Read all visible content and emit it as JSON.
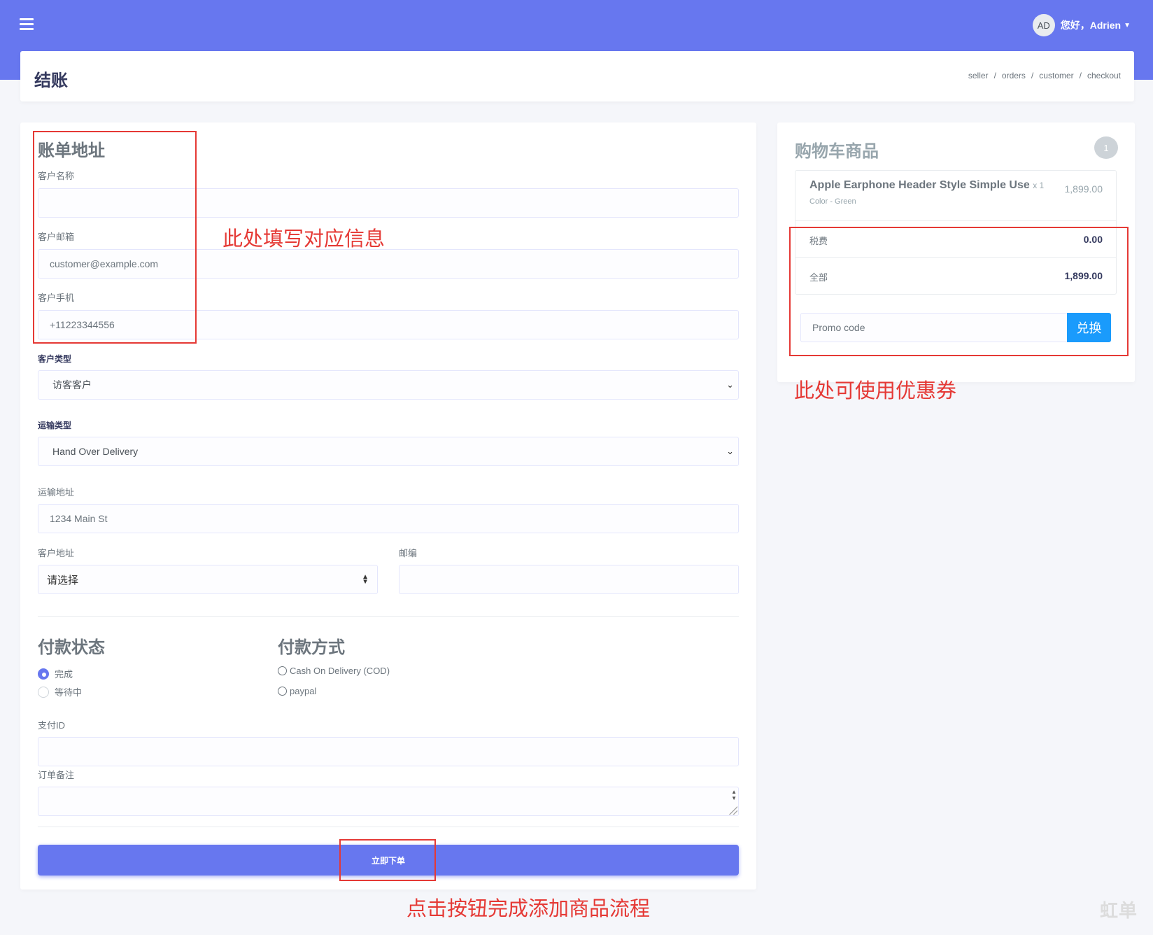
{
  "topbar": {
    "avatar_initials": "AD",
    "greeting": "您好，Adrien"
  },
  "header": {
    "title": "结账",
    "breadcrumb": [
      "seller",
      "orders",
      "customer",
      "checkout"
    ]
  },
  "billing": {
    "title": "账单地址",
    "name_label": "客户名称",
    "name_value": "",
    "email_label": "客户邮箱",
    "email_placeholder": "customer@example.com",
    "phone_label": "客户手机",
    "phone_placeholder": "+11223344556",
    "customer_type_label": "客户类型",
    "customer_type_value": "访客客户",
    "shipping_type_label": "运输类型",
    "shipping_type_value": "Hand Over Delivery",
    "shipping_address_label": "运输地址",
    "shipping_address_placeholder": "1234 Main St",
    "customer_address_label": "客户地址",
    "customer_address_value": "请选择",
    "zip_label": "邮编",
    "zip_value": ""
  },
  "payment": {
    "status_title": "付款状态",
    "status_options": [
      {
        "label": "完成",
        "checked": true
      },
      {
        "label": "等待中",
        "checked": false
      }
    ],
    "method_title": "付款方式",
    "method_options": [
      {
        "label": "Cash On Delivery (COD)",
        "checked": false
      },
      {
        "label": "paypal",
        "checked": false
      }
    ],
    "payment_id_label": "支付ID",
    "payment_id_value": "",
    "note_label": "订单备注",
    "note_value": ""
  },
  "submit_label": "立即下单",
  "cart": {
    "title": "购物车商品",
    "count": "1",
    "item": {
      "name": "Apple Earphone Header Style Simple Use",
      "qty": "x 1",
      "variant": "Color - Green",
      "price": "1,899.00"
    },
    "tax_label": "税费",
    "tax_value": "0.00",
    "total_label": "全部",
    "total_value": "1,899.00",
    "promo_placeholder": "Promo code",
    "promo_button": "兑换"
  },
  "annotations": {
    "fill_info": "此处填写对应信息",
    "coupon": "此处可使用优惠券",
    "submit": "点击按钮完成添加商品流程"
  },
  "watermark": "虹单",
  "colors": {
    "primary": "#6777ef",
    "promo_button": "#1a9bfc",
    "annotation": "#e53935"
  }
}
